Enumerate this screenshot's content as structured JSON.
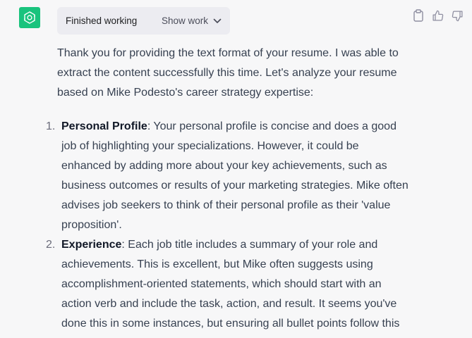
{
  "assistant": {
    "avatar_icon": "openai-logo-icon",
    "avatar_color": "#19c37d"
  },
  "work": {
    "status": "Finished working",
    "toggle_label": "Show work",
    "toggle_icon": "chevron-down-icon"
  },
  "actions": [
    {
      "name": "copy",
      "icon": "clipboard-icon"
    },
    {
      "name": "thumbs-up",
      "icon": "thumbs-up-icon"
    },
    {
      "name": "thumbs-down",
      "icon": "thumbs-down-icon"
    }
  ],
  "message": {
    "intro": "Thank you for providing the text format of your resume. I was able to extract the content successfully this time. Let's analyze your resume based on Mike Podesto's career strategy expertise:",
    "points": [
      {
        "number": "1.",
        "title": "Personal Profile",
        "body": ": Your personal profile is concise and does a good job of highlighting your specializations. However, it could be enhanced by adding more about your key achievements, such as business outcomes or results of your marketing strategies. Mike often advises job seekers to think of their personal profile as their 'value proposition'."
      },
      {
        "number": "2.",
        "title": "Experience",
        "body": ": Each job title includes a summary of your role and achievements. This is excellent, but Mike often suggests using accomplishment-oriented statements, which should start with an action verb and include the task, action, and result. It seems you've done this in some instances, but ensuring all bullet points follow this"
      }
    ]
  }
}
